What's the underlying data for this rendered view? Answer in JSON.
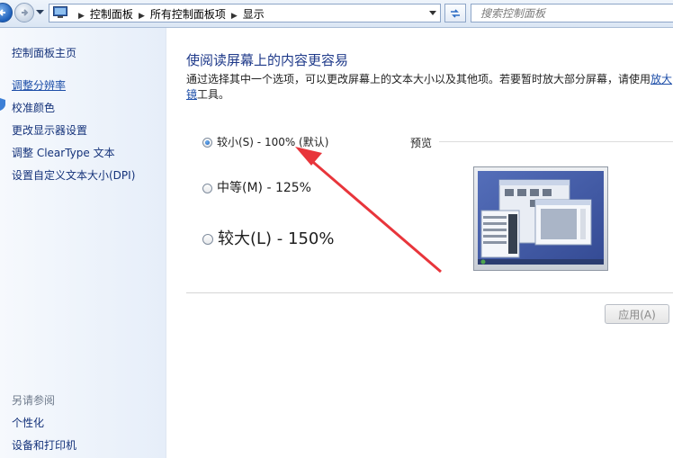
{
  "address_bar": {
    "crumbs": [
      "控制面板",
      "所有控制面板项",
      "显示"
    ],
    "search_placeholder": "搜索控制面板"
  },
  "sidebar": {
    "home": "控制面板主页",
    "links": [
      "调整分辨率",
      "校准颜色",
      "更改显示器设置",
      "调整 ClearType 文本",
      "设置自定义文本大小(DPI)"
    ],
    "see_also_title": "另请参阅",
    "see_also": [
      "个性化",
      "设备和打印机"
    ]
  },
  "main": {
    "title": "使阅读屏幕上的内容更容易",
    "description": "通过选择其中一个选项，可以更改屏幕上的文本大小以及其他项。若要暂时放大部分屏幕，请使用",
    "link_text": "放大镜",
    "description_tail": "工具。",
    "options": [
      {
        "label": "较小(S) - 100% (默认)",
        "checked": true
      },
      {
        "label": "中等(M) - 125%",
        "checked": false
      },
      {
        "label": "较大(L) - 150%",
        "checked": false
      }
    ],
    "preview_label": "预览",
    "apply_button": "应用(A)"
  },
  "colors": {
    "link": "#14327a",
    "title": "#1f3a8a",
    "annotation_arrow": "#e8353b"
  },
  "icons": [
    "back-arrow-icon",
    "forward-arrow-icon",
    "control-panel-icon",
    "refresh-icon",
    "search-icon",
    "shield-icon"
  ]
}
